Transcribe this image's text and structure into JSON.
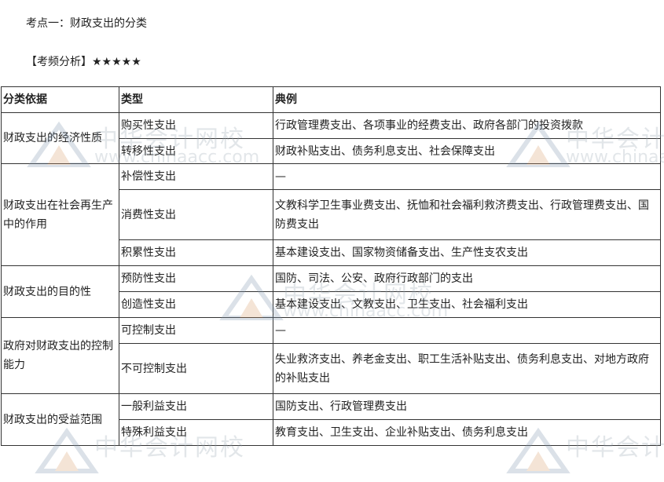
{
  "heading": "考点一：财政支出的分类",
  "frequency": {
    "label": "【考频分析】",
    "stars": "★★★★★"
  },
  "table": {
    "headers": [
      "分类依据",
      "类型",
      "典例"
    ],
    "groups": [
      {
        "basis": "财政支出的经济性质",
        "rows": [
          {
            "type": "购买性支出",
            "example": "行政管理费支出、各项事业的经费支出、政府各部门的投资拨款"
          },
          {
            "type": "转移性支出",
            "example": "财政补贴支出、债务利息支出、社会保障支出"
          }
        ]
      },
      {
        "basis": "财政支出在社会再生产中的作用",
        "rows": [
          {
            "type": "补偿性支出",
            "example": "—"
          },
          {
            "type": "消费性支出",
            "example": "文教科学卫生事业费支出、抚恤和社会福利救济费支出、行政管理费支出、国防费支出"
          },
          {
            "type": "积累性支出",
            "example": "基本建设支出、国家物资储备支出、生产性支农支出"
          }
        ]
      },
      {
        "basis": "财政支出的目的性",
        "rows": [
          {
            "type": "预防性支出",
            "example": "国防、司法、公安、政府行政部门的支出"
          },
          {
            "type": "创造性支出",
            "example": "基本建设支出、文教支出、卫生支出、社会福利支出"
          }
        ]
      },
      {
        "basis": "政府对财政支出的控制能力",
        "rows": [
          {
            "type": "可控制支出",
            "example": "—"
          },
          {
            "type": "不可控制支出",
            "example": "失业救济支出、养老金支出、职工生活补贴支出、债务利息支出、对地方政府的补贴支出"
          }
        ]
      },
      {
        "basis": "财政支出的受益范围",
        "rows": [
          {
            "type": "一般利益支出",
            "example": "国防支出、行政管理费支出"
          },
          {
            "type": "特殊利益支出",
            "example": "教育支出、卫生支出、企业补贴支出、债务利息支出"
          }
        ]
      }
    ]
  },
  "watermark": {
    "cn": "中华会计网校",
    "en": "www.chinaacc.com"
  }
}
